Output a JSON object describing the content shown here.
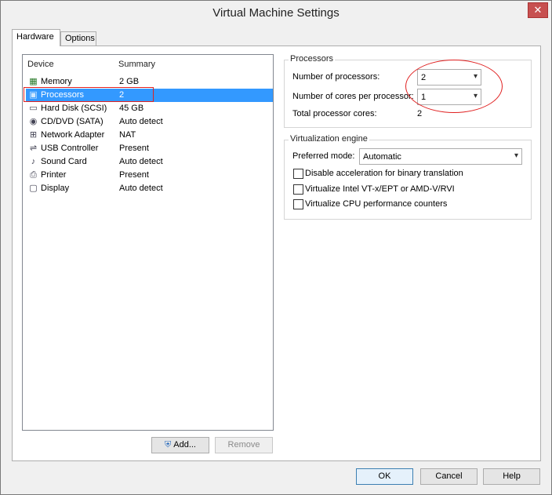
{
  "window": {
    "title": "Virtual Machine Settings",
    "close_glyph": "✕"
  },
  "tabs": [
    {
      "label": "Hardware",
      "active": true
    },
    {
      "label": "Options",
      "active": false
    }
  ],
  "device_list": {
    "columns": {
      "device": "Device",
      "summary": "Summary"
    },
    "rows": [
      {
        "name": "Memory",
        "summary": "2 GB",
        "icon": "memory-icon",
        "glyph": "▦"
      },
      {
        "name": "Processors",
        "summary": "2",
        "icon": "processor-icon",
        "glyph": "▣",
        "selected": true
      },
      {
        "name": "Hard Disk (SCSI)",
        "summary": "45 GB",
        "icon": "hard-disk-icon",
        "glyph": "▭"
      },
      {
        "name": "CD/DVD (SATA)",
        "summary": "Auto detect",
        "icon": "cd-dvd-icon",
        "glyph": "◉"
      },
      {
        "name": "Network Adapter",
        "summary": "NAT",
        "icon": "network-adapter-icon",
        "glyph": "⊞"
      },
      {
        "name": "USB Controller",
        "summary": "Present",
        "icon": "usb-icon",
        "glyph": "⇌"
      },
      {
        "name": "Sound Card",
        "summary": "Auto detect",
        "icon": "speaker-icon",
        "glyph": "♪"
      },
      {
        "name": "Printer",
        "summary": "Present",
        "icon": "printer-icon",
        "glyph": "⎙"
      },
      {
        "name": "Display",
        "summary": "Auto detect",
        "icon": "monitor-icon",
        "glyph": "▢"
      }
    ]
  },
  "list_buttons": {
    "add": "Add...",
    "remove": "Remove"
  },
  "processors": {
    "legend": "Processors",
    "num_processors_label": "Number of processors:",
    "num_processors_value": "2",
    "cores_label": "Number of cores per processor:",
    "cores_value": "1",
    "total_label": "Total processor cores:",
    "total_value": "2"
  },
  "virtualization": {
    "legend": "Virtualization engine",
    "mode_label": "Preferred mode:",
    "mode_value": "Automatic",
    "options": [
      {
        "label": "Disable acceleration for binary translation",
        "checked": false
      },
      {
        "label": "Virtualize Intel VT-x/EPT or AMD-V/RVI",
        "checked": false
      },
      {
        "label": "Virtualize CPU performance counters",
        "checked": false
      }
    ]
  },
  "dialog_buttons": {
    "ok": "OK",
    "cancel": "Cancel",
    "help": "Help"
  },
  "colors": {
    "selection": "#3399ff",
    "annotation": "#e02020"
  }
}
